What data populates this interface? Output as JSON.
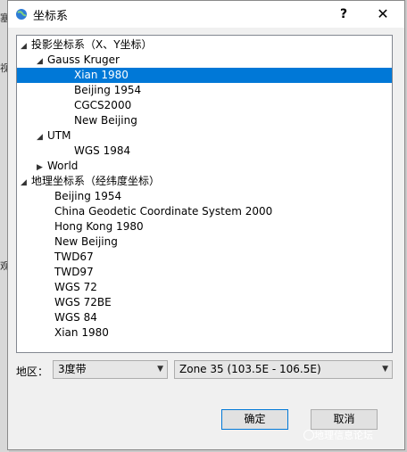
{
  "background": {
    "chars": [
      "塞",
      "视",
      "观"
    ]
  },
  "window": {
    "title": "坐标系",
    "help_label": "?",
    "close_label": "✕"
  },
  "tree": {
    "projected": {
      "label": "投影坐标系（X、Y坐标）",
      "gauss": {
        "label": "Gauss Kruger",
        "items": [
          "Xian 1980",
          "Beijing 1954",
          "CGCS2000",
          "New Beijing"
        ]
      },
      "utm": {
        "label": "UTM",
        "items": [
          "WGS 1984"
        ]
      },
      "world": {
        "label": "World"
      }
    },
    "geographic": {
      "label": "地理坐标系（经纬度坐标）",
      "items": [
        "Beijing 1954",
        "China Geodetic Coordinate System 2000",
        "Hong Kong 1980",
        "New Beijing",
        "TWD67",
        "TWD97",
        "WGS 72",
        "WGS 72BE",
        "WGS 84",
        "Xian 1980"
      ]
    },
    "selected": "Xian 1980"
  },
  "footer": {
    "zone_label": "地区：",
    "band_value": "3度带",
    "zone_value": "Zone 35 (103.5E - 106.5E)",
    "ok_label": "确定",
    "cancel_label": "取消"
  },
  "watermark": "地理信息论坛",
  "colors": {
    "selection": "#0078d7",
    "primary_border": "#0078d7"
  }
}
